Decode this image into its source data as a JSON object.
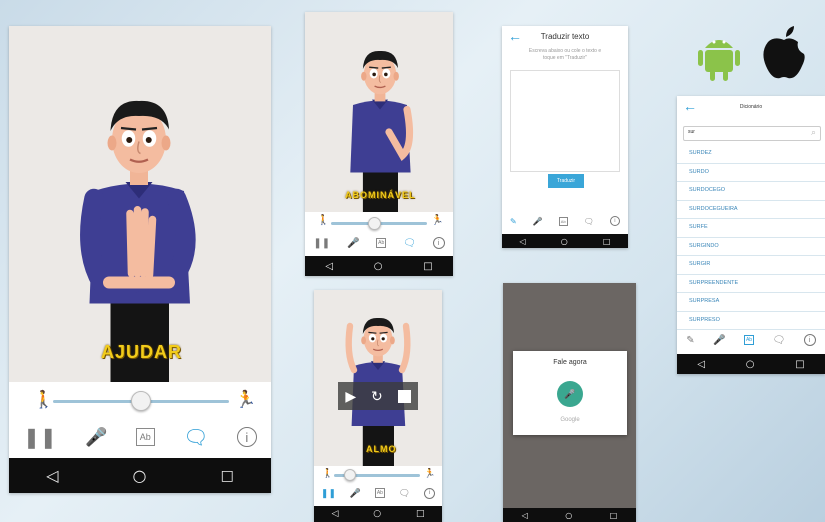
{
  "screen1": {
    "sign_word": "AJUDAR"
  },
  "screen2": {
    "sign_word": "ABOMINÁVEL"
  },
  "screen3": {
    "sign_word": "ALMO"
  },
  "translate": {
    "title": "Traduzir texto",
    "hint": "Escreva abaixo ou cole o texto e toque em \"Traduzir\"",
    "button": "Traduzir"
  },
  "speech": {
    "title": "Fale agora",
    "provider": "Google"
  },
  "dictionary": {
    "title": "Dicionário",
    "search_value": "sur",
    "items": [
      "SURDEZ",
      "SURDO",
      "SURDOCEGO",
      "SURDOCEGUEIRA",
      "SURFE",
      "SURGINDO",
      "SURGIR",
      "SURPREENDENTE",
      "SURPRESA",
      "SURPRESO"
    ]
  },
  "platforms": {
    "android_color": "#8bc34a",
    "apple_color": "#111111"
  },
  "colors": {
    "accent": "#2f9ed6",
    "word": "#f2cc1a"
  },
  "icons": {
    "slow": "walker-icon",
    "fast": "runner-icon",
    "pause": "pause-icon",
    "mic": "mic-icon",
    "ab": "ab-text-icon",
    "chat": "chat-icon",
    "info": "info-icon",
    "back": "back-triangle-icon",
    "home": "home-circle-icon",
    "recent": "recent-square-icon"
  }
}
